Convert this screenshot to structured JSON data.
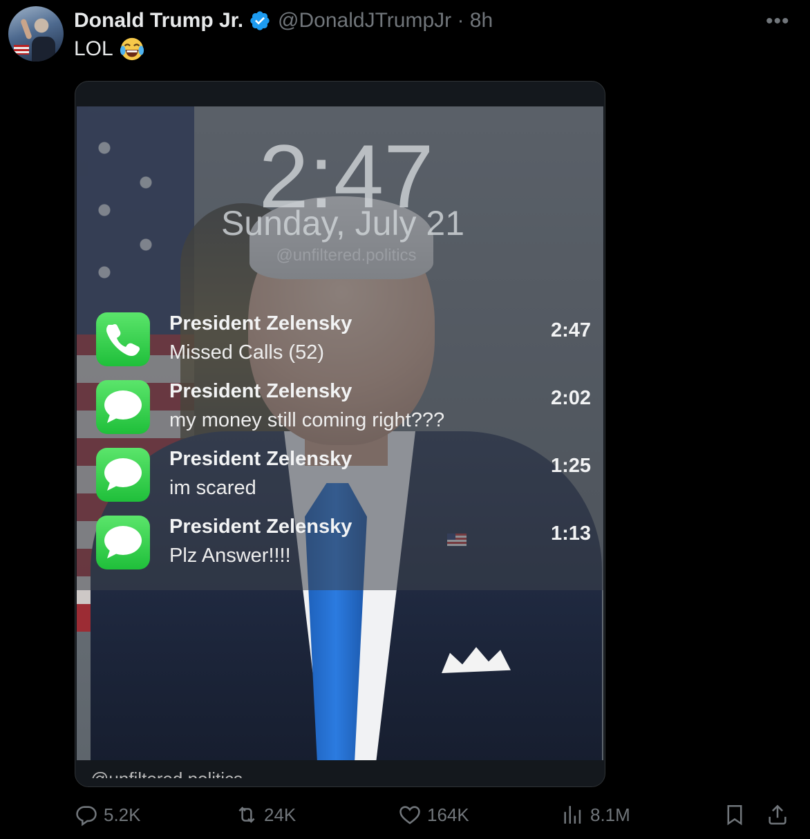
{
  "post": {
    "author_name": "Donald Trump Jr.",
    "handle_time": "@DonaldJTrumpJr · 8h",
    "text": "LOL",
    "more_icon": "more-icon"
  },
  "media": {
    "clock": "2:47",
    "date": "Sunday, July 21",
    "watermark": "@unfiltered.politics",
    "caption": "@unfiltered.politics",
    "notifications": [
      {
        "icon": "phone-icon",
        "title": "President Zelensky",
        "body": "Missed Calls (52)",
        "time": "2:47"
      },
      {
        "icon": "message-icon",
        "title": "President Zelensky",
        "body": "my money still coming right???",
        "time": "2:02"
      },
      {
        "icon": "message-icon",
        "title": "President Zelensky",
        "body": "im scared",
        "time": "1:25"
      },
      {
        "icon": "message-icon",
        "title": "President Zelensky",
        "body": "Plz Answer!!!!",
        "time": "1:13"
      }
    ]
  },
  "actions": {
    "replies": "5.2K",
    "reposts": "24K",
    "likes": "164K",
    "views": "8.1M"
  },
  "colors": {
    "background": "#000000",
    "verified": "#1d9bf0",
    "muted": "#71767b",
    "text": "#e7e9ea"
  }
}
